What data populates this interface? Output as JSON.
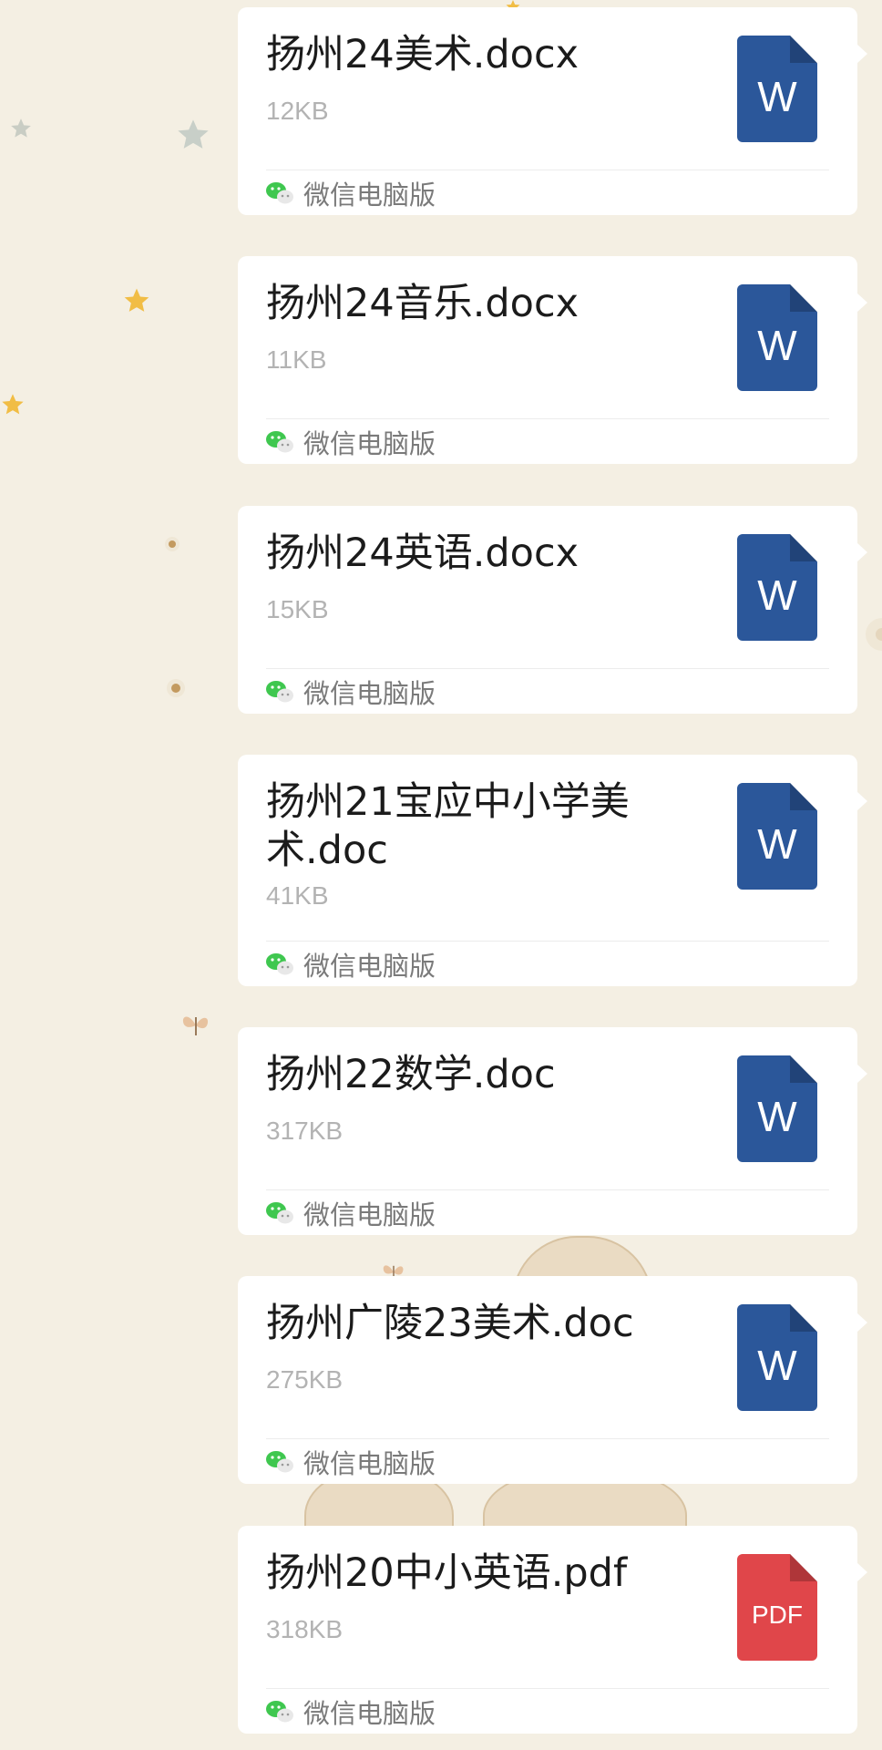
{
  "source_label": "微信电脑版",
  "messages": [
    {
      "name": "扬州24美术.docx",
      "size": "12KB",
      "icon_label": "W",
      "icon_type": "word"
    },
    {
      "name": "扬州24音乐.docx",
      "size": "11KB",
      "icon_label": "W",
      "icon_type": "word"
    },
    {
      "name": "扬州24英语.docx",
      "size": "15KB",
      "icon_label": "W",
      "icon_type": "word"
    },
    {
      "name": "扬州21宝应中小学美术.doc",
      "size": "41KB",
      "icon_label": "W",
      "icon_type": "word"
    },
    {
      "name": "扬州22数学.doc",
      "size": "317KB",
      "icon_label": "W",
      "icon_type": "word"
    },
    {
      "name": "扬州广陵23美术.doc",
      "size": "275KB",
      "icon_label": "W",
      "icon_type": "word"
    },
    {
      "name": "扬州20中小英语.pdf",
      "size": "318KB",
      "icon_label": "PDF",
      "icon_type": "pdf"
    }
  ],
  "icons": {
    "word": "word-document-icon",
    "pdf": "pdf-document-icon",
    "source": "wechat-icon"
  },
  "colors": {
    "background": "#f4efe3",
    "bubble": "#ffffff",
    "word_icon": "#2b579a",
    "pdf_icon": "#e0464a",
    "wechat_green": "#3fc74f"
  }
}
